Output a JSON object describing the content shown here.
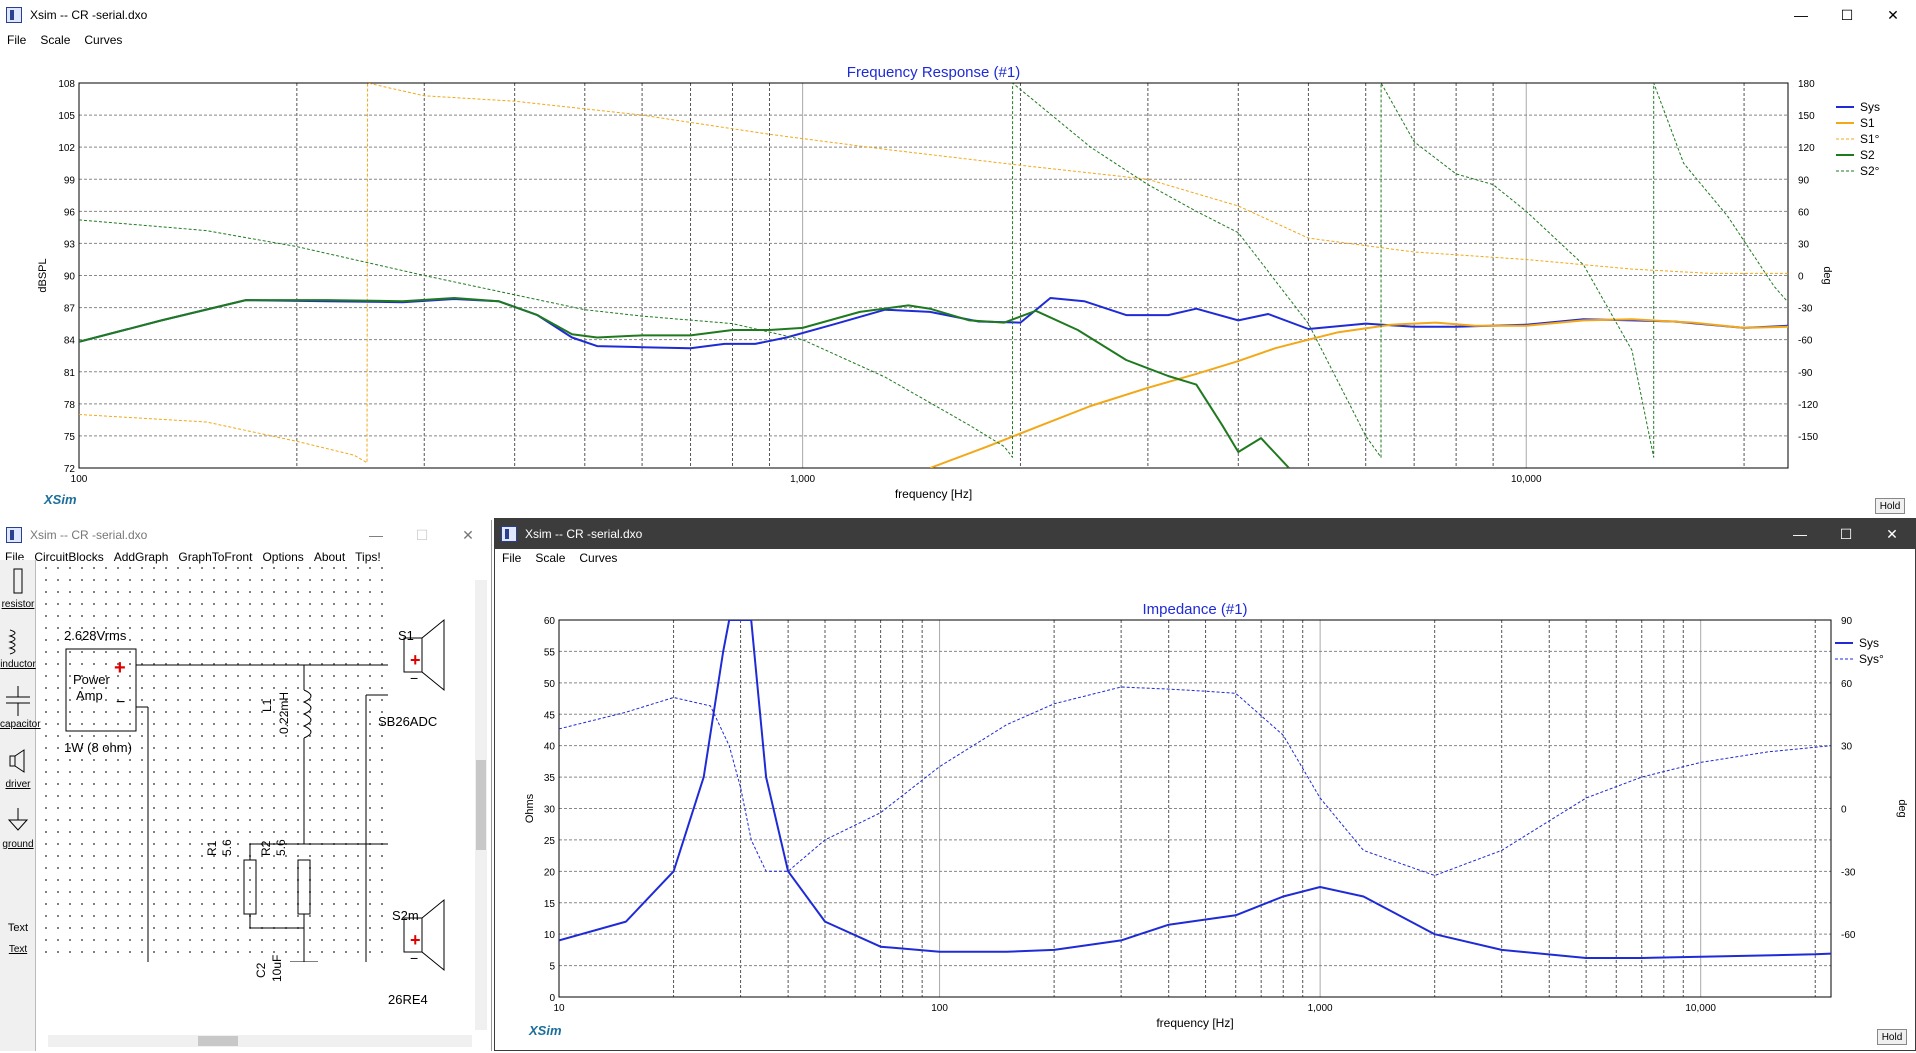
{
  "main_window": {
    "title": "Xsim -- CR -serial.dxo",
    "menu": [
      "File",
      "Scale",
      "Curves"
    ],
    "controls": {
      "minimize": "—",
      "maximize": "☐",
      "close": "✕"
    }
  },
  "freq_response": {
    "title": "Frequency Response (#1)",
    "ylabel": "dBSPL",
    "ylabel_right": "deg",
    "xlabel": "frequency [Hz]",
    "logo": "XSim",
    "hold_label": "Hold",
    "y_ticks": [
      "108",
      "105",
      "102",
      "99",
      "96",
      "93",
      "90",
      "87",
      "84",
      "81",
      "78",
      "75",
      "72"
    ],
    "y2_ticks": [
      "180",
      "150",
      "120",
      "90",
      "60",
      "30",
      "0",
      "-30",
      "-60",
      "-90",
      "-120",
      "-150"
    ],
    "x_ticks": [
      "100",
      "1,000",
      "10,000"
    ],
    "legend": [
      "Sys",
      "S1",
      "S1°",
      "S2",
      "S2°"
    ],
    "colors": {
      "Sys": "#1f2bd6",
      "S1": "#f2a818",
      "S2": "#1f7a1f"
    }
  },
  "chart_data": [
    {
      "type": "line",
      "title": "Frequency Response (#1)",
      "xlabel": "frequency [Hz]",
      "ylabel": "dBSPL",
      "y2label": "deg",
      "xscale": "log",
      "xlim": [
        100,
        23000
      ],
      "ylim": [
        72,
        108
      ],
      "y2lim": [
        -180,
        180
      ],
      "grid": true,
      "legend_position": "right",
      "series": [
        {
          "name": "Sys",
          "axis": "left",
          "style": "solid",
          "color": "#1f2bd6",
          "x": [
            100,
            130,
            170,
            220,
            280,
            330,
            380,
            430,
            480,
            520,
            600,
            700,
            780,
            860,
            950,
            1100,
            1300,
            1500,
            1750,
            2000,
            2200,
            2450,
            2800,
            3200,
            3500,
            4000,
            4400,
            5000,
            6000,
            7000,
            8000,
            10000,
            12000,
            14000,
            16000,
            20000,
            23000
          ],
          "y": [
            83.8,
            85.8,
            87.7,
            87.6,
            87.5,
            87.8,
            87.6,
            86.3,
            84.2,
            83.4,
            83.3,
            83.2,
            83.6,
            83.6,
            84.2,
            85.4,
            86.8,
            86.6,
            85.7,
            85.6,
            87.9,
            87.6,
            86.3,
            86.3,
            86.9,
            85.8,
            86.4,
            85,
            85.5,
            85.2,
            85.2,
            85.4,
            85.9,
            85.8,
            85.7,
            85.1,
            85.3
          ]
        },
        {
          "name": "S1",
          "axis": "left",
          "style": "solid",
          "color": "#f2a818",
          "x": [
            1500,
            1800,
            2100,
            2500,
            3000,
            3500,
            4000,
            4500,
            5000,
            5500,
            6500,
            7500,
            8500,
            10000,
            12000,
            14000,
            17000,
            20000,
            23000
          ],
          "y": [
            72,
            74,
            75.8,
            77.8,
            79.5,
            80.8,
            82,
            83.2,
            84,
            84.7,
            85.4,
            85.6,
            85.3,
            85.3,
            85.8,
            85.9,
            85.6,
            85.1,
            85.2
          ]
        },
        {
          "name": "S1°",
          "axis": "right",
          "style": "dashed",
          "color": "#f2a818",
          "x": [
            100,
            150,
            200,
            240,
            250,
            250.5,
            300,
            400,
            600,
            900,
            1300,
            2000,
            3000,
            4000,
            5000,
            7000,
            10000,
            14000,
            18000,
            23000
          ],
          "y": [
            -130,
            -137,
            -155,
            -168,
            -175,
            180,
            168,
            163,
            150,
            132,
            118,
            103,
            90,
            65,
            35,
            22,
            15,
            6,
            2,
            2
          ]
        },
        {
          "name": "S2",
          "axis": "left",
          "style": "solid",
          "color": "#1f7a1f",
          "x": [
            100,
            130,
            170,
            220,
            280,
            330,
            380,
            430,
            480,
            520,
            600,
            700,
            800,
            900,
            1000,
            1200,
            1400,
            1500,
            1700,
            1900,
            2100,
            2400,
            2800,
            3200,
            3500,
            3800,
            4000,
            4300,
            4700
          ],
          "y": [
            83.8,
            85.8,
            87.7,
            87.7,
            87.6,
            87.9,
            87.6,
            86.3,
            84.5,
            84.2,
            84.4,
            84.4,
            84.9,
            84.9,
            85.1,
            86.6,
            87.2,
            86.9,
            85.8,
            85.6,
            86.7,
            84.9,
            82.1,
            80.6,
            79.8,
            76,
            73.5,
            74.8,
            72
          ]
        },
        {
          "name": "S2°",
          "axis": "right",
          "style": "dashed",
          "color": "#1f7a1f",
          "x": [
            100,
            150,
            200,
            300,
            400,
            500,
            600,
            800,
            1000,
            1300,
            1700,
            1900,
            1950,
            1950.5,
            2500,
            3000,
            3500,
            4000,
            5000,
            6000,
            6300,
            6300.5,
            7000,
            8000,
            9000,
            10000,
            12000,
            14000,
            15000,
            15000.5,
            16500,
            19000,
            22000,
            23000
          ],
          "y": [
            52,
            42,
            27,
            0,
            -18,
            -32,
            -38,
            -45,
            -60,
            -95,
            -140,
            -160,
            -170,
            180,
            120,
            85,
            60,
            40,
            -45,
            -150,
            -170,
            180,
            125,
            95,
            85,
            60,
            10,
            -70,
            -170,
            180,
            105,
            55,
            -10,
            -25
          ]
        }
      ]
    },
    {
      "type": "line",
      "title": "Impedance (#1)",
      "xlabel": "frequency [Hz]",
      "ylabel": "Ohms",
      "y2label": "deg",
      "xscale": "log",
      "xlim": [
        10,
        22000
      ],
      "ylim": [
        0,
        60
      ],
      "y2lim": [
        -90,
        90
      ],
      "grid": true,
      "legend_position": "right",
      "series": [
        {
          "name": "Sys",
          "axis": "left",
          "style": "solid",
          "color": "#1f2bd6",
          "x": [
            10,
            15,
            20,
            24,
            27,
            28,
            32,
            35,
            40,
            50,
            70,
            100,
            150,
            200,
            300,
            400,
            600,
            800,
            1000,
            1300,
            2000,
            3000,
            5000,
            7000,
            10000,
            20000,
            22000
          ],
          "y": [
            9,
            12,
            20,
            35,
            55,
            60,
            60,
            35,
            20,
            12,
            8,
            7.2,
            7.2,
            7.5,
            9,
            11.5,
            13,
            16,
            17.5,
            16,
            10,
            7.5,
            6.2,
            6.2,
            6.4,
            6.8,
            6.9
          ]
        },
        {
          "name": "Sys°",
          "axis": "right",
          "style": "dashed",
          "color": "#1f2bd6",
          "x": [
            10,
            15,
            20,
            25,
            28,
            30,
            32,
            35,
            40,
            50,
            70,
            100,
            150,
            200,
            300,
            400,
            500,
            600,
            800,
            1000,
            1300,
            2000,
            3000,
            5000,
            7000,
            10000,
            15000,
            22000
          ],
          "y": [
            38,
            46,
            53,
            49,
            30,
            10,
            -15,
            -30,
            -30,
            -15,
            -2,
            20,
            40,
            50,
            58,
            57,
            56,
            55,
            35,
            5,
            -20,
            -32,
            -20,
            5,
            15,
            22,
            27,
            30
          ]
        }
      ]
    }
  ],
  "circuit_window": {
    "title": "Xsim -- CR -serial.dxo",
    "menu": [
      "File",
      "CircuitBlocks",
      "AddGraph",
      "GraphToFront",
      "Options",
      "About",
      "Tips!"
    ],
    "controls": {
      "minimize": "—",
      "maximize": "☐",
      "close": "✕"
    },
    "palette": [
      {
        "icon": "resistor-icon",
        "label": "resistor"
      },
      {
        "icon": "inductor-icon",
        "label": "inductor"
      },
      {
        "icon": "capacitor-icon",
        "label": "capacitor"
      },
      {
        "icon": "driver-icon",
        "label": "driver"
      },
      {
        "icon": "ground-icon",
        "label": "ground"
      },
      {
        "icon": "text-icon",
        "label": "Text",
        "glyph": "Text"
      }
    ],
    "amp": {
      "voltage": "2.628Vrms",
      "name_line1": "Power",
      "name_line2": "Amp",
      "power": "1W (8 ohm)",
      "plus": "+",
      "minus": "−"
    },
    "L1": {
      "name": "L1",
      "value": "0.22mH"
    },
    "R1": {
      "name": "R1",
      "value": "5.6"
    },
    "R2": {
      "name": "R2",
      "value": "5.6"
    },
    "C2": {
      "name": "C2",
      "value": "10uF"
    },
    "S1": {
      "name": "S1",
      "model": "SB26ADC"
    },
    "S2": {
      "name": "S2m",
      "model": "26RE4"
    }
  },
  "impedance": {
    "window_title": "Xsim -- CR -serial.dxo",
    "menu": [
      "File",
      "Scale",
      "Curves"
    ],
    "title": "Impedance (#1)",
    "ylabel": "Ohms",
    "ylabel_right": "deg",
    "xlabel": "frequency [Hz]",
    "logo": "XSim",
    "hold_label": "Hold",
    "y_ticks": [
      "60",
      "55",
      "50",
      "45",
      "40",
      "35",
      "30",
      "25",
      "20",
      "15",
      "10",
      "5",
      "0"
    ],
    "y2_ticks": [
      "90",
      "60",
      "30",
      "0",
      "-30",
      "-60"
    ],
    "x_ticks": [
      "10",
      "100",
      "1,000",
      "10,000"
    ],
    "legend": [
      "Sys",
      "Sys°"
    ],
    "colors": {
      "Sys": "#1f2bd6"
    }
  }
}
